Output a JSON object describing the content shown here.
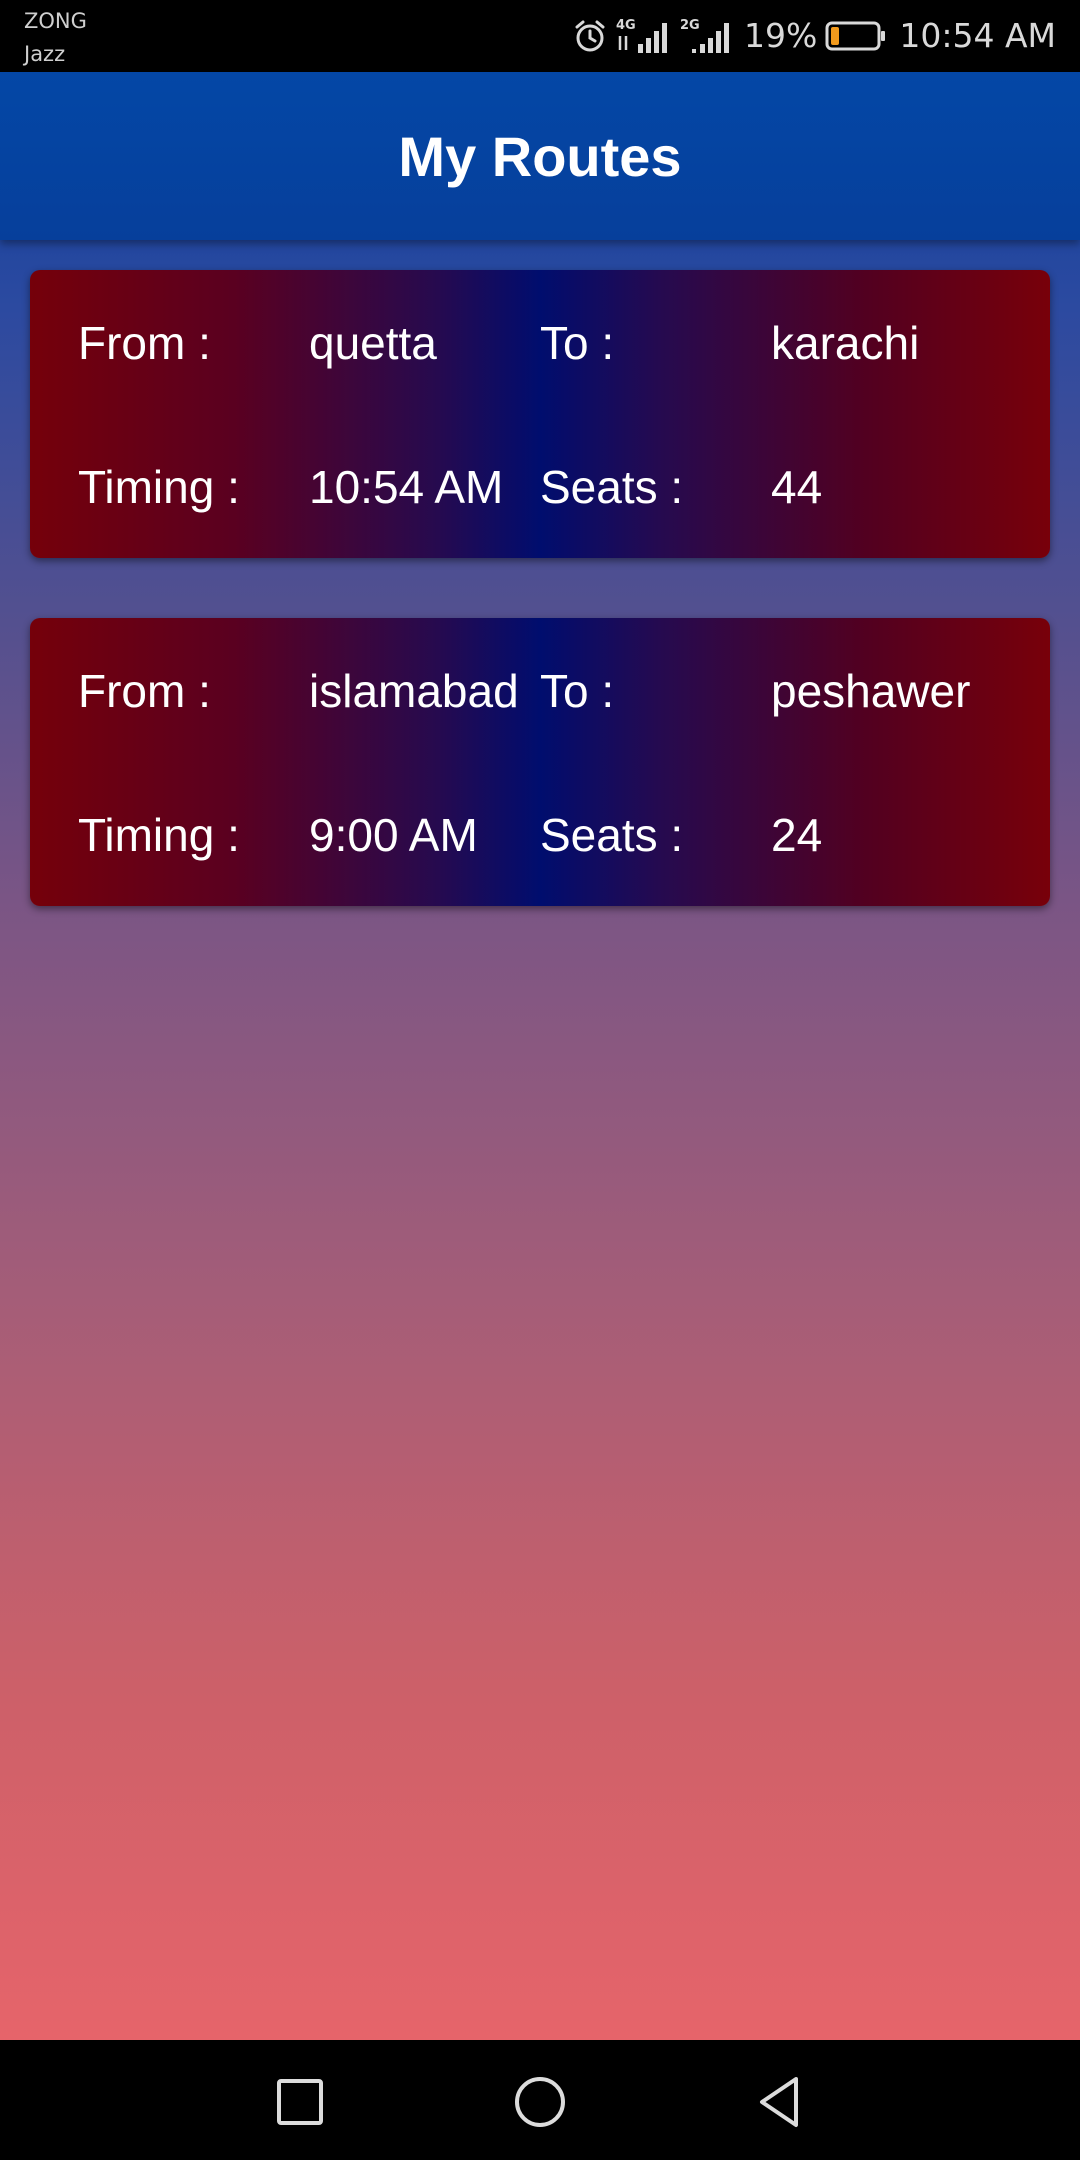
{
  "status_bar": {
    "carrier_primary": "ZONG",
    "carrier_secondary": "Jazz",
    "battery_percent": "19%",
    "time": "10:54 AM",
    "battery_level": 0.19,
    "icons": [
      "alarm-icon",
      "signal-4g-icon",
      "signal-2g-icon",
      "battery-icon"
    ],
    "network_labels": [
      "4G",
      "2G"
    ]
  },
  "app_bar": {
    "title": "My Routes",
    "color": "#0447a6"
  },
  "routes": [
    {
      "from_label": "From :",
      "from_value": "quetta",
      "to_label": "To :",
      "to_value": "karachi",
      "timing_label": "Timing :",
      "timing_value": "10:54 AM",
      "seats_label": "Seats :",
      "seats_value": "44"
    },
    {
      "from_label": "From :",
      "from_value": "islamabad",
      "to_label": "To :",
      "to_value": "peshawer",
      "timing_label": "Timing :",
      "timing_value": "9:00 AM",
      "seats_label": "Seats :",
      "seats_value": "24"
    }
  ],
  "nav_bar": {
    "icons": [
      "recent-apps-icon",
      "home-icon",
      "back-icon"
    ]
  },
  "colors": {
    "card_edge": "#75000a",
    "card_center": "#000d6e",
    "background_top": "#0b3e9c",
    "background_bottom": "#e6646a"
  }
}
